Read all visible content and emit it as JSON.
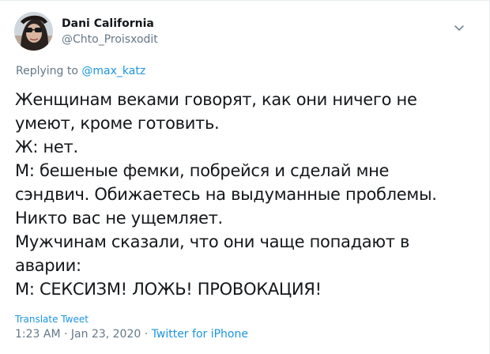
{
  "author": {
    "display_name": "Dani California",
    "handle": "@Chto_Proisxodit"
  },
  "reply": {
    "prefix": "Replying to",
    "mention": "@max_katz"
  },
  "tweet": {
    "lines": [
      "Женщинам веками говорят, как они ничего не",
      "умеют, кроме готовить.",
      "Ж: нет.",
      "М: бешеные фемки, побрейся и сделай мне",
      "сэндвич. Обижаетесь на выдуманные проблемы.",
      "Никто вас не ущемляет.",
      "Мужчинам сказали, что они чаще попадают в",
      "аварии:",
      "М: СЕКСИЗМ! ЛОЖЬ! ПРОВОКАЦИЯ!"
    ]
  },
  "translate_label": "Translate Tweet",
  "meta": {
    "time": "1:23 AM",
    "separator": "·",
    "date": "Jan 23, 2020",
    "source": "Twitter for iPhone"
  },
  "colors": {
    "link": "#1b95e0",
    "secondary": "#657786",
    "text": "#14171a"
  },
  "icons": {
    "menu": "chevron-down-icon"
  }
}
